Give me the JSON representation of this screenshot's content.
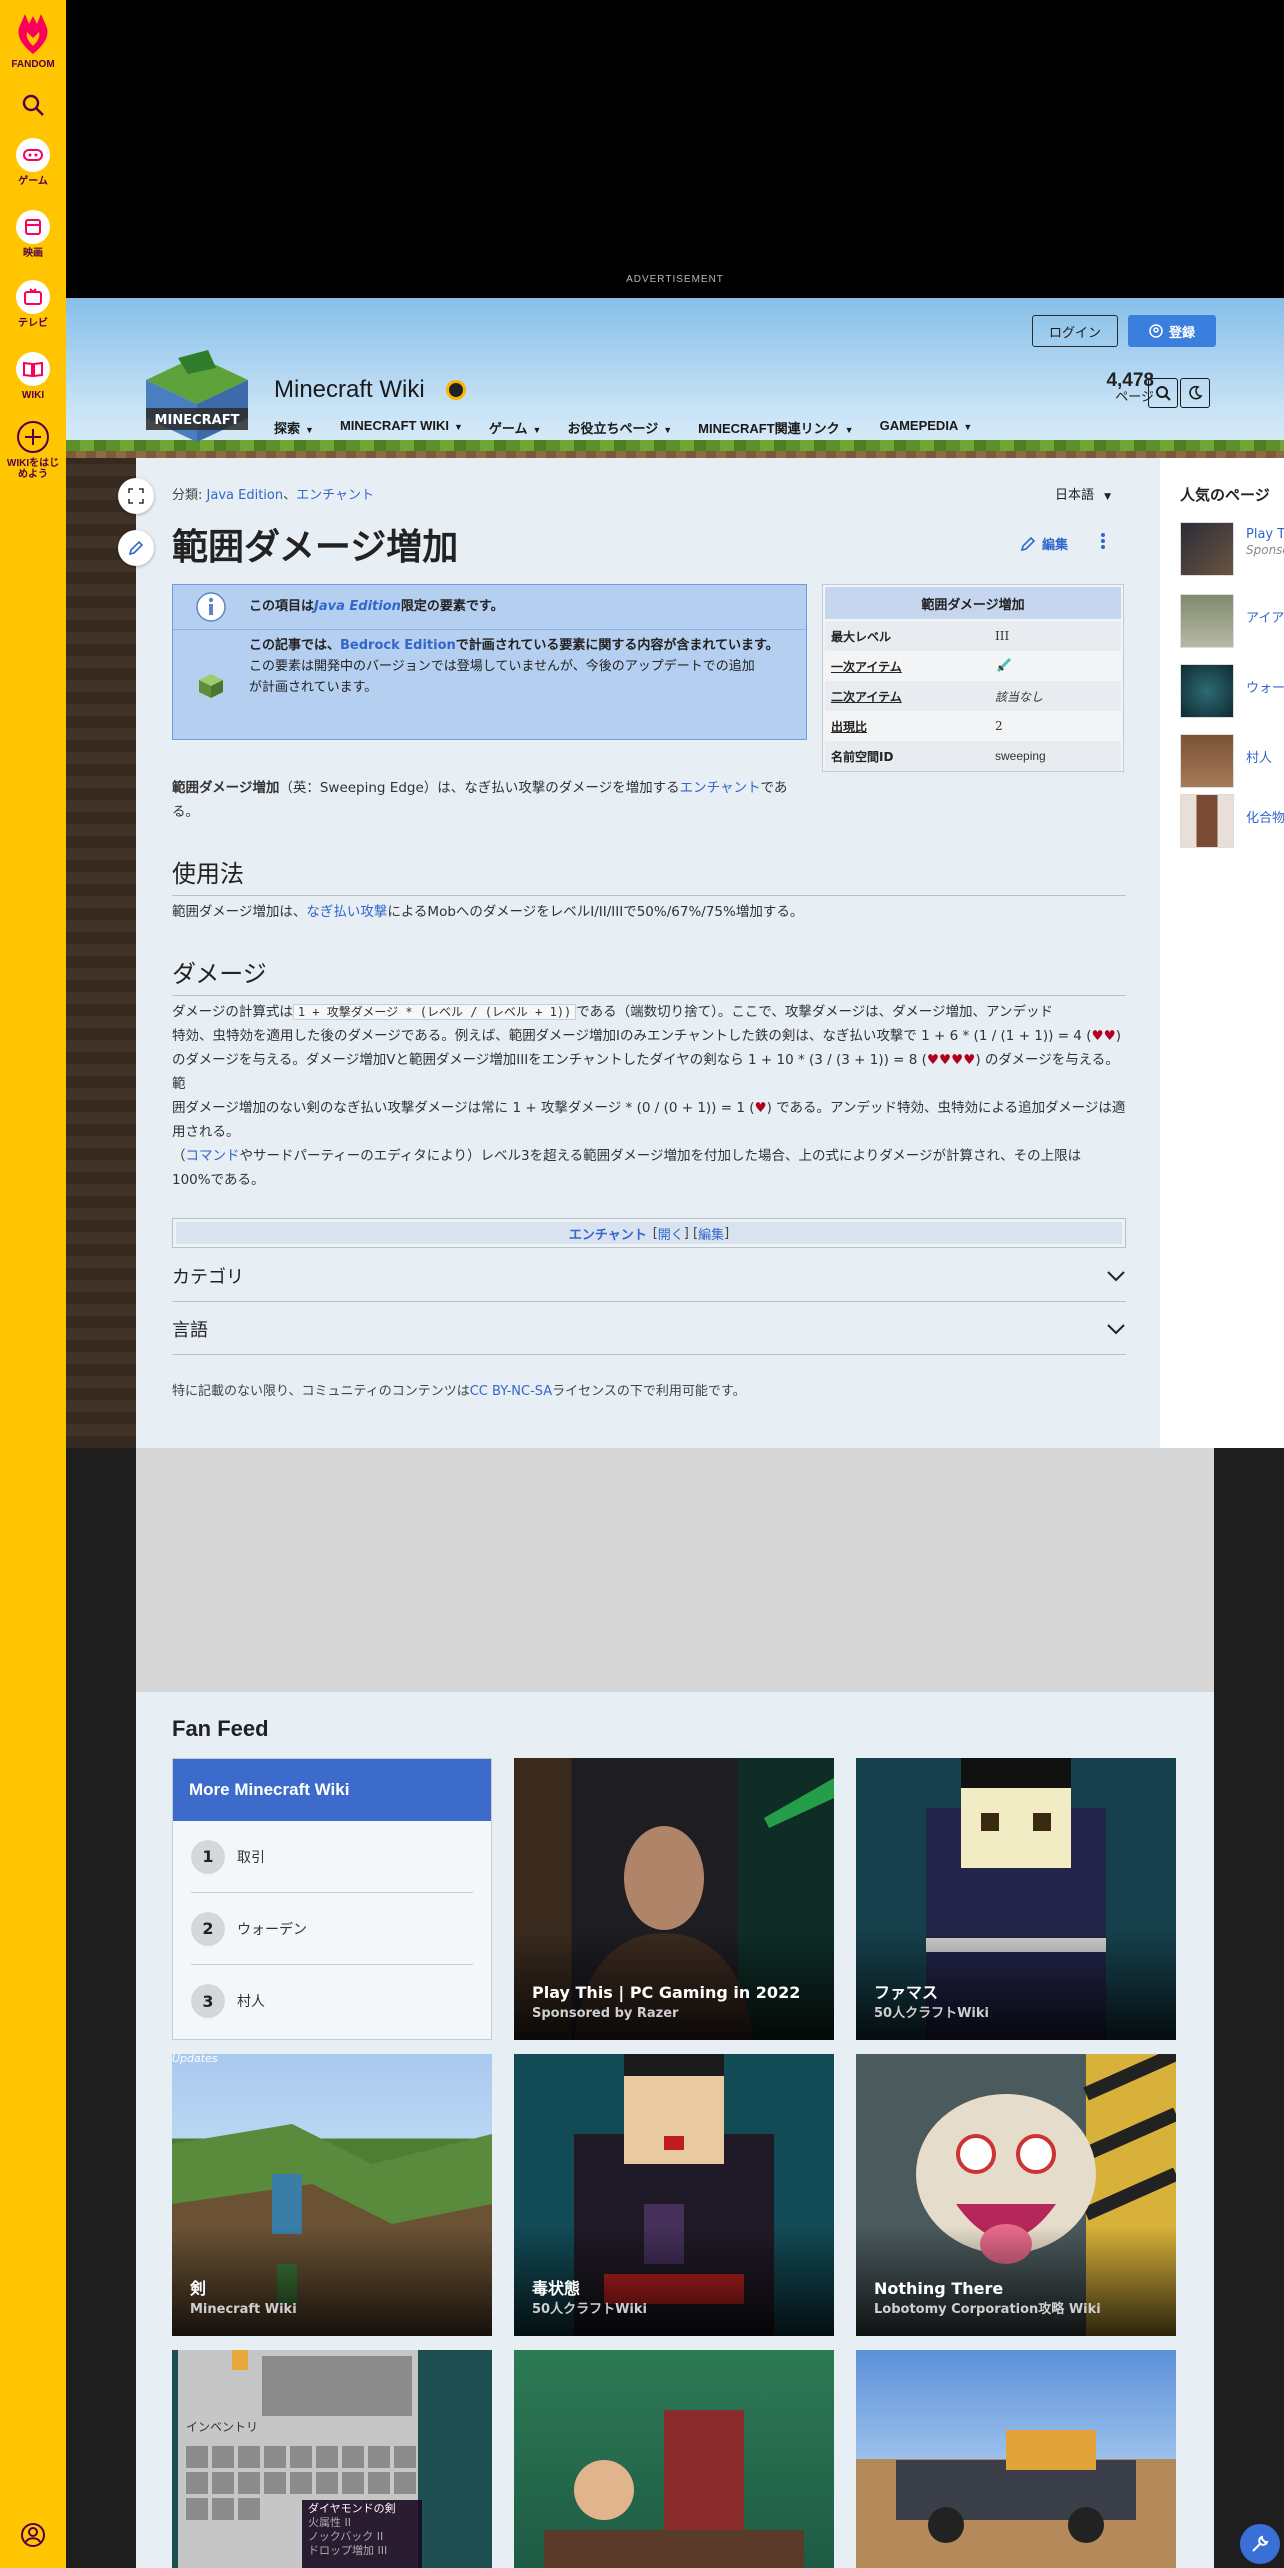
{
  "rail": {
    "brand": "FANDOM",
    "items": [
      {
        "label": "ゲーム",
        "icon": "gamepad-icon"
      },
      {
        "label": "映画",
        "icon": "film-icon"
      },
      {
        "label": "テレビ",
        "icon": "tv-icon"
      },
      {
        "label": "WIKI",
        "icon": "book-icon"
      }
    ],
    "start_wiki": "WIKIをはじめよう"
  },
  "ad": {
    "label": "ADVERTISEMENT"
  },
  "header": {
    "wiki_name": "Minecraft Wiki",
    "nav": [
      "探索",
      "MINECRAFT WIKI",
      "ゲーム",
      "お役立ちページ",
      "MINECRAFT関連リンク",
      "GAMEPEDIA"
    ],
    "login": "ログイン",
    "signup": "登録",
    "page_count": "4,478",
    "page_count_label": "ページ"
  },
  "article": {
    "categories_label": "分類:",
    "categories": [
      "Java Edition",
      "エンチャント"
    ],
    "categories_sep": "、",
    "language": "日本語",
    "title": "範囲ダメージ増加",
    "edit": "編集",
    "notice1_pre": "この項目は",
    "notice1_link": "Java Edition",
    "notice1_post": "限定の要素です。",
    "notice2_pre": "この記事では、",
    "notice2_link": "Bedrock Edition",
    "notice2_post": "で計画されている要素に関する内容が含まれています。",
    "notice2_line2": "この要素は開発中のバージョンでは登場していませんが、今後のアップデートでの追加",
    "notice2_line3": "が計画されています。",
    "intro_bold": "範囲ダメージ増加",
    "intro_mid": "（英：Sweeping Edge）は、なぎ払い攻撃のダメージを増加する",
    "intro_link": "エンチャント",
    "intro_post": "であ",
    "intro_line2": "る。",
    "usage_heading": "使用法",
    "usage_pre": "範囲ダメージ増加は、",
    "usage_link": "なぎ払い攻撃",
    "usage_post": "によるMobへのダメージをレベルI/II/IIIで50%/67%/75%増加する。",
    "damage_heading": "ダメージ",
    "damage_p1_pre": "ダメージの計算式は",
    "damage_formula": "1 + 攻撃ダメージ * (レベル / (レベル + 1))",
    "damage_p1_l1_post": "である（端数切り捨て）。ここで、攻撃ダメージは、ダメージ増加、アンデッド",
    "damage_p1_l2_pre": "特効、虫特効を適用した後のダメージである。例えば、範囲ダメージ増加Iのみエンチャントした鉄の剣は、なぎ払い攻撃で 1 + 6 * (1 / (1 + 1)) = 4 (",
    "hearts2": "♥♥",
    "damage_p1_l2_post": ")",
    "damage_p1_l3_pre": "のダメージを与える。ダメージ増加Vと範囲ダメージ増加IIIをエンチャントしたダイヤの剣なら 1 + 10 * (3 / (3 + 1)) = 8 (",
    "hearts4": "♥♥♥♥",
    "damage_p1_l3_post": ") のダメージを与える。範",
    "damage_p1_l4_pre": "囲ダメージ増加のない剣のなぎ払い攻撃ダメージは常に 1 + 攻撃ダメージ * (0 / (0 + 1)) = 1 (",
    "hearts1": "♥",
    "damage_p1_l4_post": ") である。アンデッド特効、虫特効による追加ダメージは適",
    "damage_p1_l5": "用される。",
    "damage_p2_pre": "（",
    "damage_p2_link": "コマンド",
    "damage_p2_post": "やサードパーティーのエディタにより）レベル3を超える範囲ダメージ増加を付加した場合、上の式によりダメージが計算され、その上限は",
    "damage_p2_line2": "100%である。",
    "navbox_title": "エンチャント",
    "navbox_open": "開く",
    "navbox_edit": "編集",
    "categories_section": "カテゴリ",
    "languages_section": "言語",
    "license_pre": "特に記載のない限り、コミュニティのコンテンツは",
    "license_link": "CC BY-NC-SA",
    "license_post": "ライセンスの下で利用可能です。"
  },
  "infobox": {
    "title": "範囲ダメージ増加",
    "rows": [
      {
        "key": "最大レベル",
        "value": "III"
      },
      {
        "key": "一次アイテム",
        "value": ""
      },
      {
        "key": "二次アイテム",
        "value": "該当なし"
      },
      {
        "key": "出現比",
        "value": "2"
      },
      {
        "key": "名前空間ID",
        "value": "sweeping"
      }
    ]
  },
  "popular": {
    "title": "人気のページ",
    "items": [
      {
        "title": "Play This | PC Gaming",
        "sub": "Sponsored"
      },
      {
        "title": "アイアンゴーレム",
        "sub": ""
      },
      {
        "title": "ウォーデン",
        "sub": ""
      },
      {
        "title": "村人",
        "sub": ""
      },
      {
        "title": "化合物作成機",
        "sub": ""
      }
    ]
  },
  "fanfeed": {
    "title": "Fan Feed",
    "more_title": "More Minecraft Wiki",
    "more_items": [
      {
        "num": "1",
        "label": "取引"
      },
      {
        "num": "2",
        "label": "ウォーデン"
      },
      {
        "num": "3",
        "label": "村人"
      }
    ],
    "cards": [
      {
        "title": "Play This | PC Gaming in 2022",
        "sub": "Sponsored by Razer"
      },
      {
        "title": "ファマス",
        "sub": "50人クラフトWiki"
      },
      {
        "title": "剣",
        "sub": "Minecraft Wiki"
      },
      {
        "title": "毒状態",
        "sub": "50人クラフトWiki"
      },
      {
        "title": "Nothing There",
        "sub": "Lobotomy Corporation攻略 Wiki"
      }
    ],
    "overlay_text": "Updates",
    "inventory_label": "インベントリ",
    "tooltip_title": "ダイヤモンドの剣",
    "tooltip_lines": [
      "火属性 II",
      "ノックバック II",
      "ドロップ増加 III"
    ],
    "colors": {
      "header": "#3d6bcc",
      "rail": "#ffc500",
      "accent": "#3366cc"
    }
  }
}
